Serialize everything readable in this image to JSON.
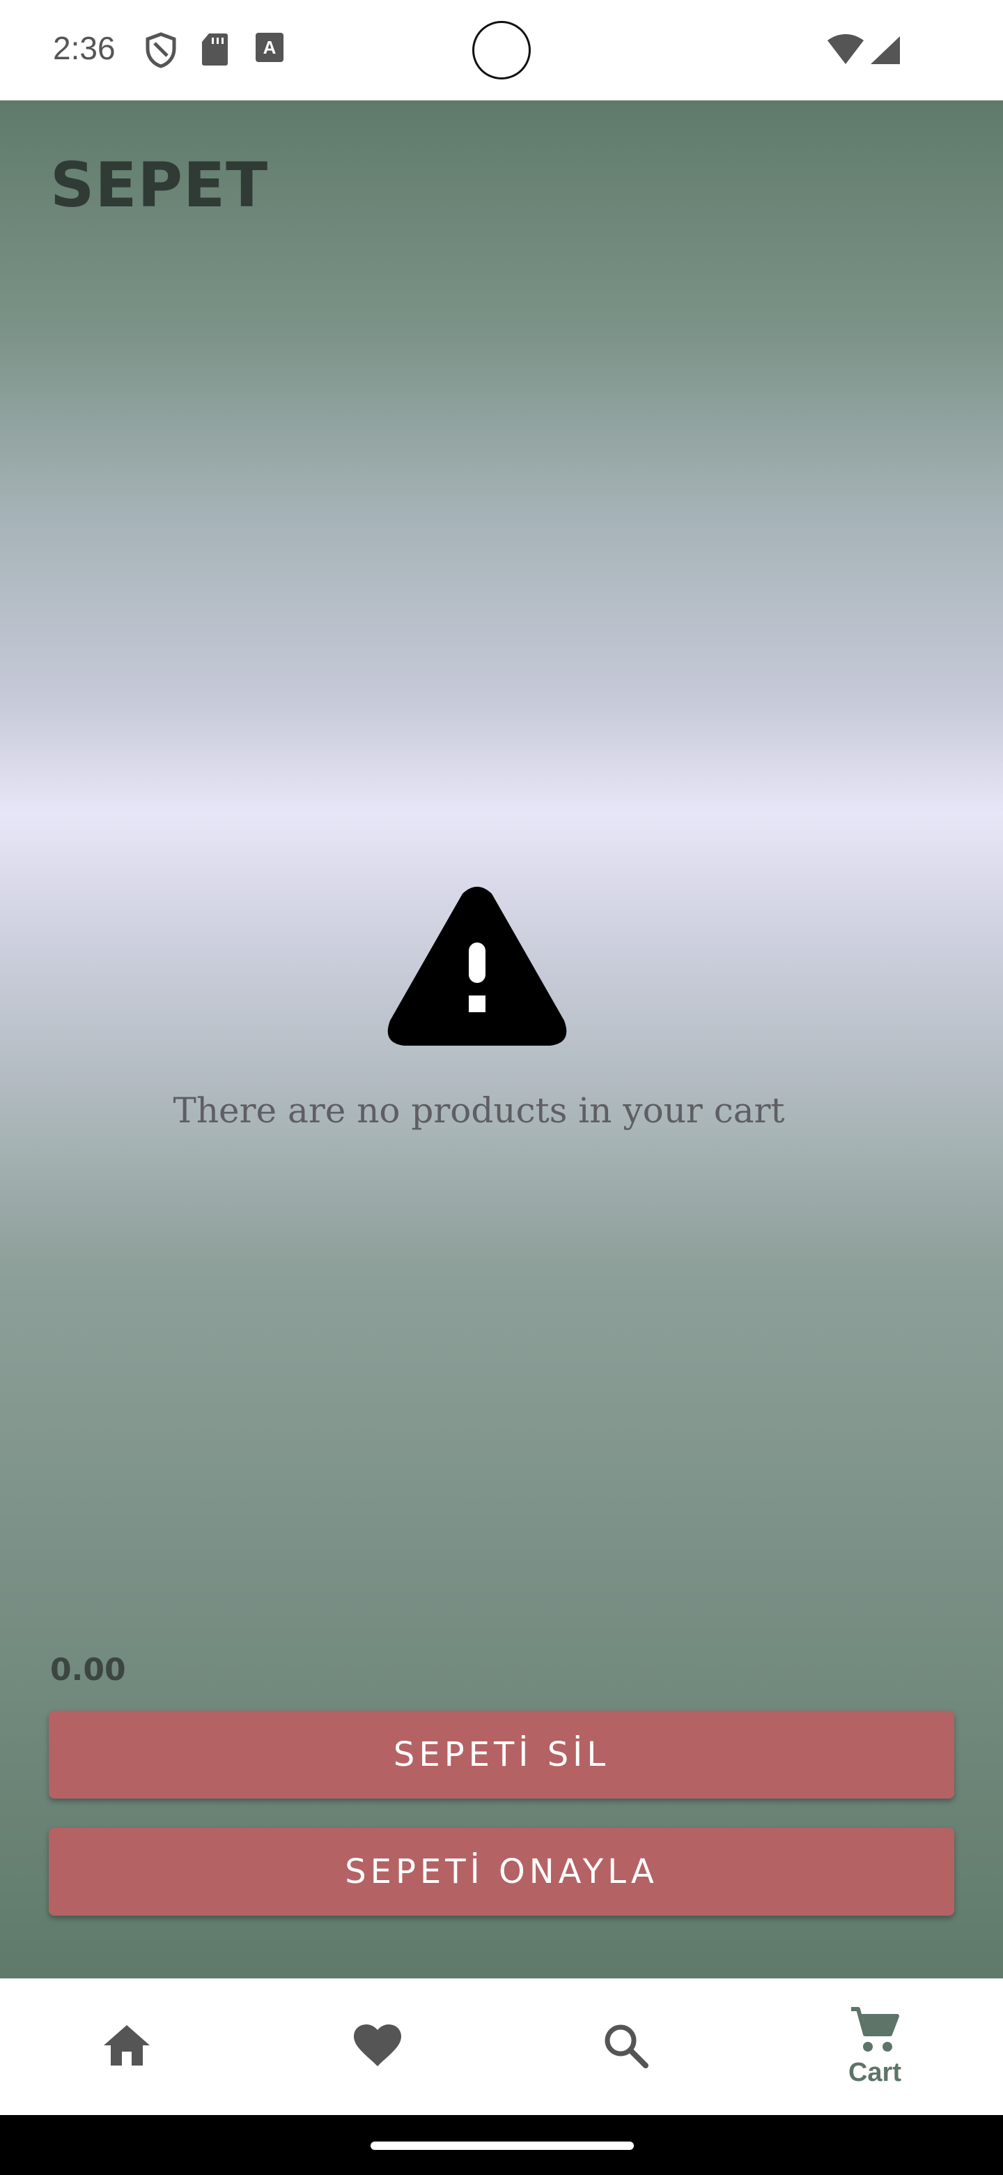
{
  "status_bar": {
    "time": "2:36",
    "icons": [
      "shield-icon",
      "sd-card-icon",
      "font-icon",
      "wifi-icon",
      "cell-signal-icon"
    ]
  },
  "page": {
    "title": "SEPET"
  },
  "empty_state": {
    "icon": "warning-icon",
    "message": "There are no products in your cart"
  },
  "cart": {
    "total": "0.00",
    "delete_label": "SEPETİ SİL",
    "confirm_label": "SEPETİ ONAYLA"
  },
  "bottom_nav": {
    "items": [
      {
        "icon": "home-icon",
        "label": ""
      },
      {
        "icon": "heart-icon",
        "label": ""
      },
      {
        "icon": "search-icon",
        "label": ""
      },
      {
        "icon": "cart-icon",
        "label": "Cart"
      }
    ]
  },
  "colors": {
    "accent": "#b56264",
    "nav_active": "#5d7468",
    "nav_inactive": "#555555"
  }
}
